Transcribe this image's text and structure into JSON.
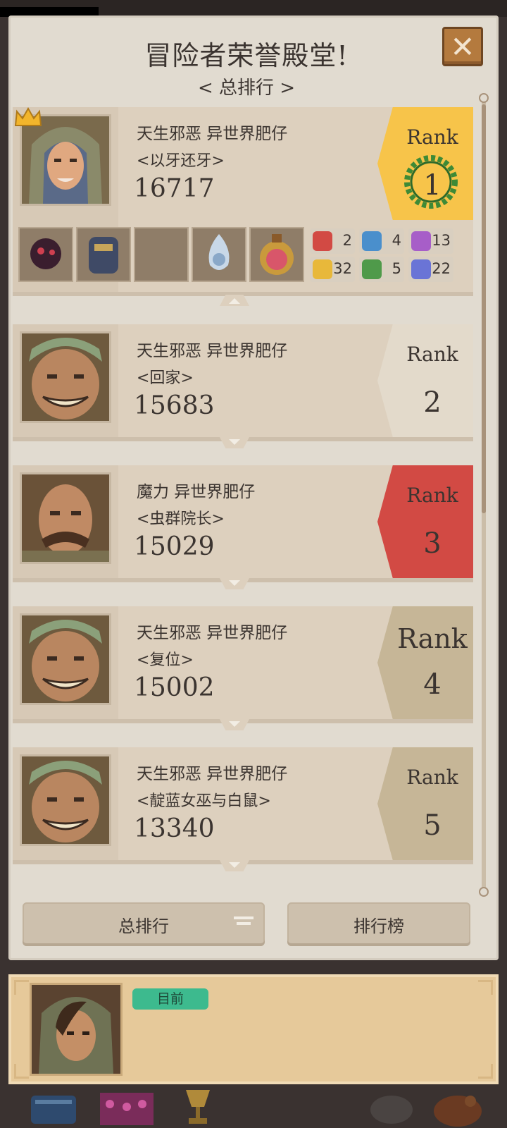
{
  "header": {
    "title": "冒险者荣誉殿堂!",
    "subtitle": "< 总排行 >"
  },
  "close": {
    "label": "✕"
  },
  "entries": [
    {
      "rank_word": "Rank",
      "rank": "1",
      "name": "天生邪恶 异世界肥仔",
      "tag": "<以牙还牙>",
      "score": "16717",
      "badge_color": "#f7c44a"
    },
    {
      "rank_word": "Rank",
      "rank": "2",
      "name": "天生邪恶 异世界肥仔",
      "tag": "<回家>",
      "score": "15683",
      "badge_color": "#e3dacb"
    },
    {
      "rank_word": "Rank",
      "rank": "3",
      "name": "魔力 异世界肥仔",
      "tag": "<虫群院长>",
      "score": "15029",
      "badge_color": "#d24a44"
    },
    {
      "rank_word": "Rank",
      "rank": "4",
      "name": "天生邪恶 异世界肥仔",
      "tag": "<复位>",
      "score": "15002",
      "badge_color": "#c6b697"
    },
    {
      "rank_word": "Rank",
      "rank": "5",
      "name": "天生邪恶 异世界肥仔",
      "tag": "<靛蓝女巫与白鼠>",
      "score": "13340",
      "badge_color": "#c6b697"
    }
  ],
  "first_stats": [
    {
      "icon": "red-fist-icon",
      "value": "2",
      "color": "#d24a44"
    },
    {
      "icon": "blue-puzzle-icon",
      "value": "4",
      "color": "#4a8fcc"
    },
    {
      "icon": "purple-spirit-icon",
      "value": "13",
      "color": "#a75ec8"
    },
    {
      "icon": "gold-coin-icon",
      "value": "32",
      "color": "#e8b83a"
    },
    {
      "icon": "green-heart-icon",
      "value": "5",
      "color": "#4f9a4a"
    },
    {
      "icon": "blue-target-icon",
      "value": "22",
      "color": "#6a74d6"
    }
  ],
  "footer": {
    "total_label": "总排行",
    "board_label": "排行榜"
  },
  "player": {
    "status_label": "目前"
  }
}
